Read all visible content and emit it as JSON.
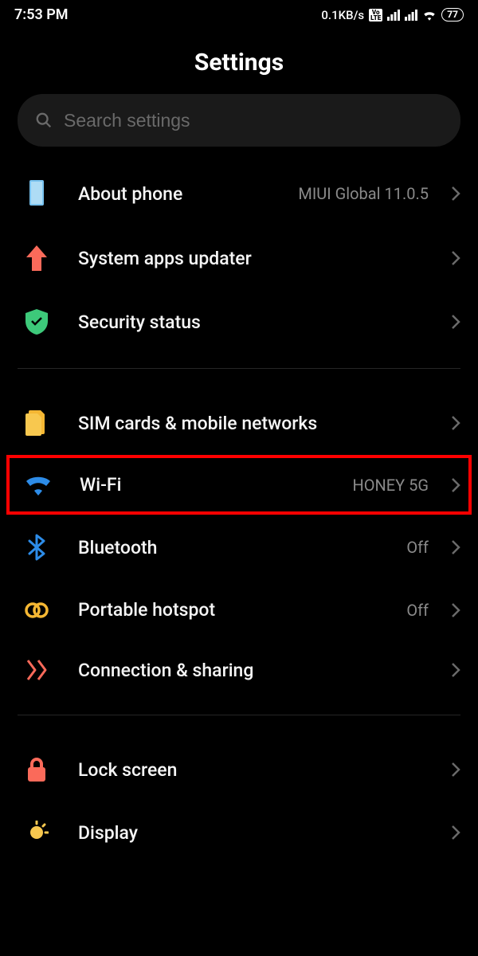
{
  "status": {
    "time": "7:53 PM",
    "net_speed": "0.1KB/s",
    "battery": "77",
    "volte": "Vo\nLTE"
  },
  "header": {
    "title": "Settings"
  },
  "search": {
    "placeholder": "Search settings"
  },
  "items": {
    "about": {
      "label": "About phone",
      "value": "MIUI Global 11.0.5"
    },
    "updater": {
      "label": "System apps updater"
    },
    "security": {
      "label": "Security status"
    },
    "sim": {
      "label": "SIM cards & mobile networks"
    },
    "wifi": {
      "label": "Wi-Fi",
      "value": "HONEY 5G"
    },
    "bluetooth": {
      "label": "Bluetooth",
      "value": "Off"
    },
    "hotspot": {
      "label": "Portable hotspot",
      "value": "Off"
    },
    "connection": {
      "label": "Connection & sharing"
    },
    "lock": {
      "label": "Lock screen"
    },
    "display": {
      "label": "Display"
    }
  }
}
